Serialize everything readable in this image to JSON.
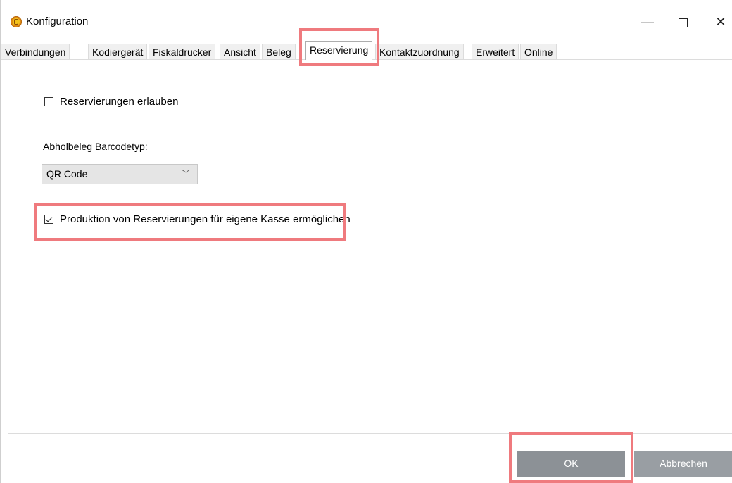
{
  "window": {
    "title": "Konfiguration",
    "controls": {
      "minimize": "—",
      "close": "✕"
    }
  },
  "tabs": [
    {
      "label": "Verbindungen"
    },
    {
      "label": "Kodiergerät"
    },
    {
      "label": "Fiskaldrucker"
    },
    {
      "label": "Ansicht"
    },
    {
      "label": "Beleg"
    },
    {
      "label": "Reservierung",
      "active": true
    },
    {
      "label": "Kontaktzuordnung"
    },
    {
      "label": "Erweitert"
    },
    {
      "label": "Online"
    }
  ],
  "reservierung": {
    "allow_checkbox": {
      "label": "Reservierungen erlauben",
      "checked": false
    },
    "barcode_label": "Abholbeleg Barcodetyp:",
    "barcode_select": {
      "value": "QR Code"
    },
    "production_checkbox": {
      "label": "Produktion von Reservierungen für eigene Kasse ermöglichen",
      "checked": true
    }
  },
  "footer": {
    "ok_label": "OK",
    "cancel_label": "Abbrechen"
  },
  "colors": {
    "highlight": "#ef7a7e",
    "button_bg": "#8c9196"
  }
}
